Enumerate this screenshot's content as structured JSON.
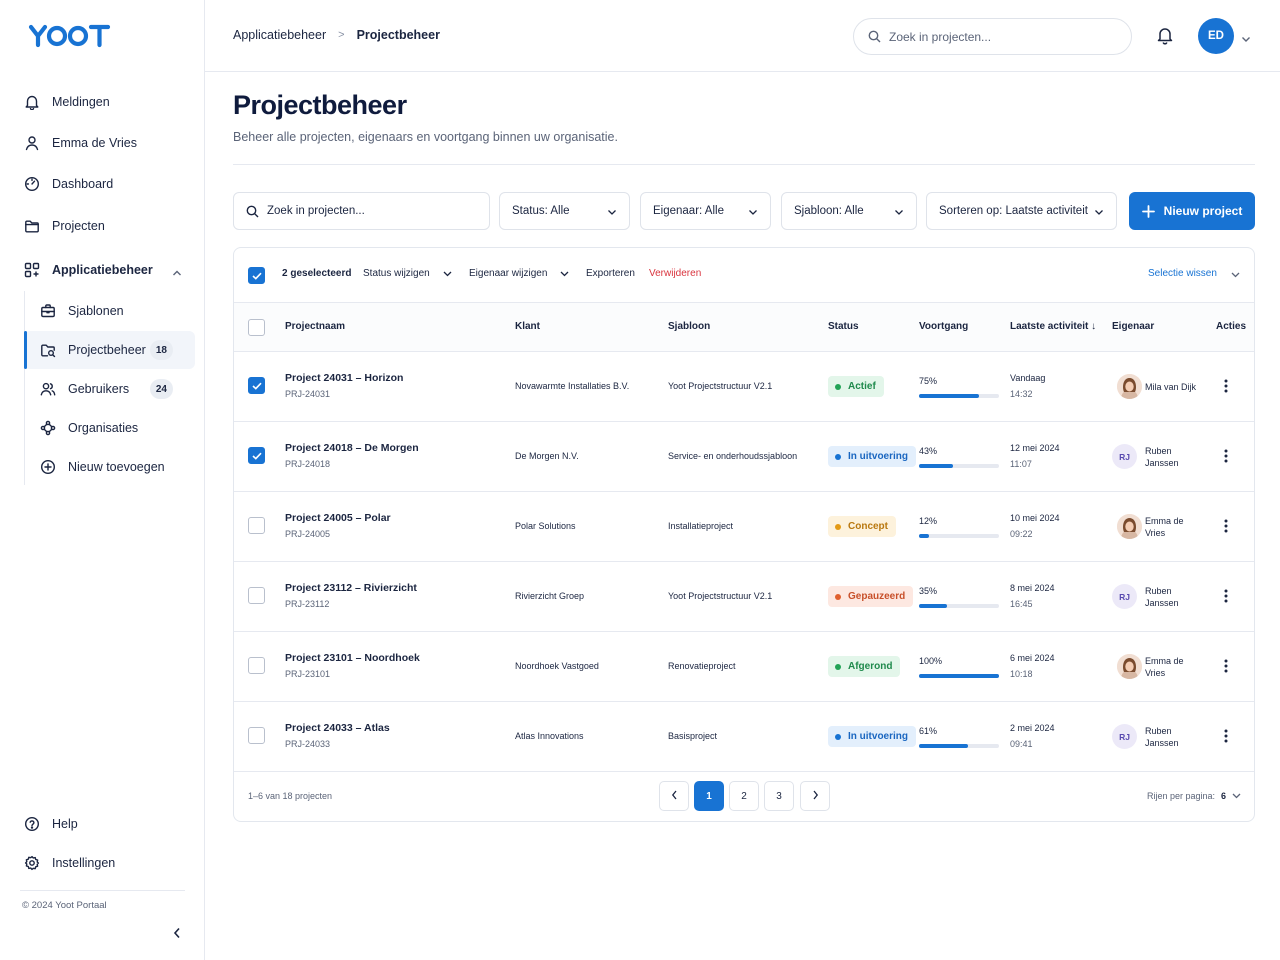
{
  "brand": {
    "logo_text": "YOOT",
    "accent": "#1873d3"
  },
  "sidebar": {
    "top_items": [
      {
        "label": "Meldingen",
        "icon": "bell-icon"
      },
      {
        "label": "Emma de Vries",
        "icon": "user-icon"
      },
      {
        "label": "Dashboard",
        "icon": "dashboard-icon"
      },
      {
        "label": "Projecten",
        "icon": "folder-icon"
      },
      {
        "label": "Applicatiebeheer",
        "icon": "grid-icon"
      }
    ],
    "sub_items": [
      {
        "label": "Sjablonen",
        "icon": "briefcase-icon",
        "count": ""
      },
      {
        "label": "Projectbeheer",
        "icon": "folder-search-icon",
        "count": "18"
      },
      {
        "label": "Gebruikers",
        "icon": "users-icon",
        "count": "24"
      },
      {
        "label": "Organisaties",
        "icon": "network-icon",
        "count": ""
      },
      {
        "label": "Nieuw toevoegen",
        "icon": "plus-circle-icon",
        "count": ""
      }
    ],
    "bottom_items": [
      {
        "label": "Help",
        "icon": "help-icon"
      },
      {
        "label": "Instellingen",
        "icon": "gear-icon"
      }
    ],
    "copyright": "© 2024 Yoot Portaal"
  },
  "topbar": {
    "breadcrumb_parent": "Applicatiebeheer",
    "breadcrumb_separator": ">",
    "breadcrumb_current": "Projectbeheer",
    "search_placeholder": "Zoek in projecten...",
    "avatar_initials": "ED"
  },
  "header": {
    "title": "Projectbeheer",
    "subtitle": "Beheer alle projecten, eigenaars en voortgang binnen uw organisatie."
  },
  "filters": {
    "search_placeholder": "Zoek in projecten...",
    "status": "Status: Alle",
    "owner": "Eigenaar: Alle",
    "template": "Sjabloon: Alle",
    "sort": "Sorteren op: Laatste activiteit",
    "new_button": "Nieuw project"
  },
  "bulk": {
    "selected": "2 geselecteerd",
    "change_status": "Status wijzigen",
    "change_owner": "Eigenaar wijzigen",
    "export": "Exporteren",
    "delete": "Verwijderen",
    "clear": "Selectie wissen"
  },
  "table": {
    "columns": [
      "Projectnaam",
      "Klant",
      "Sjabloon",
      "Status",
      "Voortgang",
      "Laatste activiteit ↓",
      "Eigenaar",
      "Acties"
    ],
    "rows": [
      {
        "checked": true,
        "name": "Project 24031 – Horizon",
        "id": "PRJ-24031",
        "client": "Novawarmte Installaties B.V.",
        "template": "Yoot Projectstructuur V2.1",
        "status": "Actief",
        "status_kind": "active",
        "progress": 75,
        "progress_label": "75%",
        "date": "Vandaag",
        "time": "14:32",
        "owner_line1": "Mila van Dijk",
        "owner_line2": "",
        "owner_avatar": "photo",
        "owner_initials": ""
      },
      {
        "checked": true,
        "name": "Project 24018 – De Morgen",
        "id": "PRJ-24018",
        "client": "De Morgen N.V.",
        "template": "Service- en onderhoudssjabloon",
        "status": "In uitvoering",
        "status_kind": "progress",
        "progress": 43,
        "progress_label": "43%",
        "date": "12 mei 2024",
        "time": "11:07",
        "owner_line1": "Ruben",
        "owner_line2": "Janssen",
        "owner_avatar": "initials",
        "owner_initials": "RJ"
      },
      {
        "checked": false,
        "name": "Project 24005 – Polar",
        "id": "PRJ-24005",
        "client": "Polar Solutions",
        "template": "Installatieproject",
        "status": "Concept",
        "status_kind": "concept",
        "progress": 12,
        "progress_label": "12%",
        "date": "10 mei 2024",
        "time": "09:22",
        "owner_line1": "Emma de",
        "owner_line2": "Vries",
        "owner_avatar": "photo",
        "owner_initials": ""
      },
      {
        "checked": false,
        "name": "Project 23112 – Rivierzicht",
        "id": "PRJ-23112",
        "client": "Rivierzicht Groep",
        "template": "Yoot Projectstructuur V2.1",
        "status": "Gepauzeerd",
        "status_kind": "paused",
        "progress": 35,
        "progress_label": "35%",
        "date": "8 mei 2024",
        "time": "16:45",
        "owner_line1": "Ruben",
        "owner_line2": "Janssen",
        "owner_avatar": "initials",
        "owner_initials": "RJ"
      },
      {
        "checked": false,
        "name": "Project 23101 – Noordhoek",
        "id": "PRJ-23101",
        "client": "Noordhoek Vastgoed",
        "template": "Renovatieproject",
        "status": "Afgerond",
        "status_kind": "done",
        "progress": 100,
        "progress_label": "100%",
        "date": "6 mei 2024",
        "time": "10:18",
        "owner_line1": "Emma de",
        "owner_line2": "Vries",
        "owner_avatar": "photo",
        "owner_initials": ""
      },
      {
        "checked": false,
        "name": "Project 24033 – Atlas",
        "id": "PRJ-24033",
        "client": "Atlas Innovations",
        "template": "Basisproject",
        "status": "In uitvoering",
        "status_kind": "progress",
        "progress": 61,
        "progress_label": "61%",
        "date": "2 mei 2024",
        "time": "09:41",
        "owner_line1": "Ruben",
        "owner_line2": "Janssen",
        "owner_avatar": "initials",
        "owner_initials": "RJ"
      }
    ]
  },
  "status_colors": {
    "active": {
      "bg": "#e3f6ea",
      "fg": "#1f8a4c",
      "dot": "#22a356"
    },
    "progress": {
      "bg": "#e3effc",
      "fg": "#1a66c0",
      "dot": "#1873d3"
    },
    "concept": {
      "bg": "#fdf2dc",
      "fg": "#b9780f",
      "dot": "#e39a15"
    },
    "paused": {
      "bg": "#fde8e1",
      "fg": "#c8502a",
      "dot": "#e0602f"
    },
    "done": {
      "bg": "#e3f6ea",
      "fg": "#1f8a4c",
      "dot": "#22a356"
    }
  },
  "footer": {
    "range": "1–6 van 18 projecten",
    "pages": [
      "1",
      "2",
      "3"
    ],
    "active_page": "1",
    "rows_per_page_label": "Rijen per pagina:",
    "rows_per_page": "6"
  }
}
